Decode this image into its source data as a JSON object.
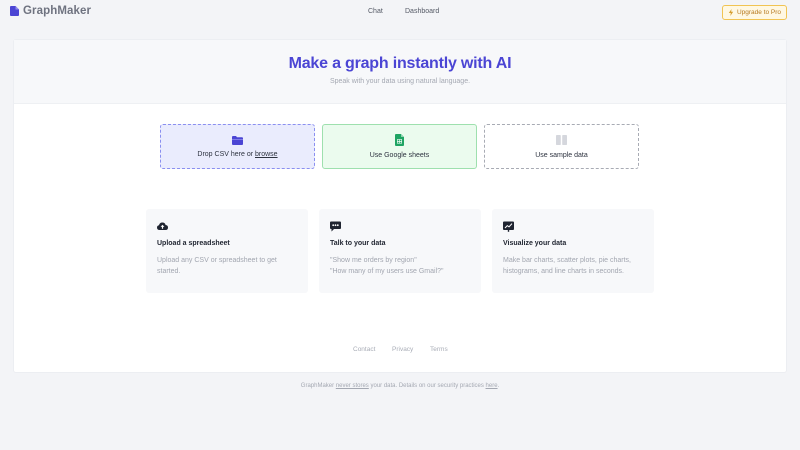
{
  "brand": {
    "name": "GraphMaker",
    "icon": "document-icon",
    "color": "#4b45d4"
  },
  "nav": {
    "chat": "Chat",
    "dashboard": "Dashboard"
  },
  "upgrade": {
    "label": "Upgrade to Pro",
    "icon": "lightning-icon"
  },
  "hero": {
    "title": "Make a graph instantly with AI",
    "subtitle": "Speak with your data using natural language."
  },
  "sources": {
    "csv": {
      "prefix": "Drop CSV here or ",
      "link": "browse",
      "icon": "folder-icon"
    },
    "sheets": {
      "label": "Use Google sheets",
      "icon": "google-sheets-icon"
    },
    "sample": {
      "label": "Use sample data",
      "icon": "columns-icon"
    }
  },
  "features": [
    {
      "icon": "cloud-upload-icon",
      "title": "Upload a spreadsheet",
      "desc": "Upload any CSV or spreadsheet to get started."
    },
    {
      "icon": "chat-icon",
      "title": "Talk to your data",
      "desc_lines": [
        "\"Show me orders by region\"",
        "\"How many of my users use Gmail?\""
      ]
    },
    {
      "icon": "chart-icon",
      "title": "Visualize your data",
      "desc": "Make bar charts, scatter plots, pie charts, histograms, and line charts in seconds."
    }
  ],
  "footer": {
    "contact": "Contact",
    "privacy": "Privacy",
    "terms": "Terms"
  },
  "note": {
    "part1": "GraphMaker ",
    "link1": "never stores",
    "part2": " your data. Details on our security practices ",
    "link2": "here",
    "part3": "."
  },
  "colors": {
    "accent": "#4b45d4",
    "csv_bg": "#eaecfd",
    "sheets_green": "#1fa463",
    "upgrade_border": "#f1c453"
  }
}
